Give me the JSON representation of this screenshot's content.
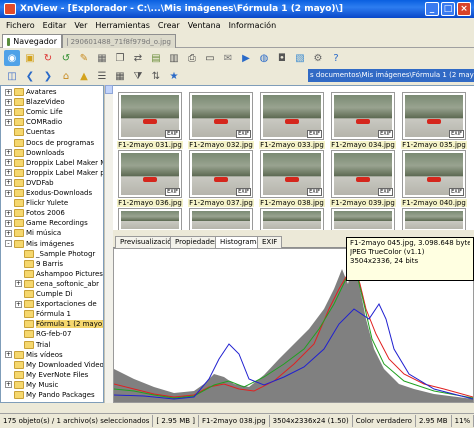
{
  "window": {
    "title": "XnView - [Explorador - C:\\...\\Mis imágenes\\Fórmula 1 (2 mayo)\\]"
  },
  "menu": [
    "Fichero",
    "Editar",
    "Ver",
    "Herramientas",
    "Crear",
    "Ventana",
    "Información"
  ],
  "tabs": [
    {
      "label": "Navegador"
    },
    {
      "label": "290601488_71f8f979d_o.jpg"
    }
  ],
  "path": "s documentos\\Mis imágenes\\Fórmula 1 (2 mayo)\\",
  "tree": {
    "items": [
      {
        "label": "Avatares",
        "pm": "+"
      },
      {
        "label": "BlazeVideo",
        "pm": "+"
      },
      {
        "label": "Comic Life",
        "pm": "+"
      },
      {
        "label": "COMRadio",
        "pm": "+"
      },
      {
        "label": "Cuentas",
        "pm": ""
      },
      {
        "label": "Docs de programas",
        "pm": ""
      },
      {
        "label": "Downloads",
        "pm": "+"
      },
      {
        "label": "Droppix Label Maker M",
        "pm": "+"
      },
      {
        "label": "Droppix Label Maker p",
        "pm": "+"
      },
      {
        "label": "DVDFab",
        "pm": "+"
      },
      {
        "label": "Exodus-Downloads",
        "pm": "+"
      },
      {
        "label": "Flickr Yulete",
        "pm": ""
      },
      {
        "label": "Fotos 2006",
        "pm": "+"
      },
      {
        "label": "Game Recordings",
        "pm": "+"
      },
      {
        "label": "Mi música",
        "pm": "+"
      },
      {
        "label": "Mis imágenes",
        "pm": "-"
      },
      {
        "label": "_Sample Photogr",
        "pm": ""
      },
      {
        "label": "9 Barris",
        "pm": ""
      },
      {
        "label": "Ashampoo Pictures",
        "pm": ""
      },
      {
        "label": "cena_softonic_abr",
        "pm": "+"
      },
      {
        "label": "Cumple Di",
        "pm": ""
      },
      {
        "label": "Exportaciones de",
        "pm": "+"
      },
      {
        "label": "Fórmula 1",
        "pm": ""
      },
      {
        "label": "Fórmula 1 (2 mayo)",
        "pm": "",
        "selected": true
      },
      {
        "label": "RG-feb-07",
        "pm": ""
      },
      {
        "label": "Trial",
        "pm": ""
      },
      {
        "label": "Mis vídeos",
        "pm": "+"
      },
      {
        "label": "My Downloaded Video",
        "pm": ""
      },
      {
        "label": "My EverNote Files",
        "pm": ""
      },
      {
        "label": "My Music",
        "pm": "+"
      },
      {
        "label": "My Pando Packages",
        "pm": ""
      }
    ]
  },
  "thumbnails": [
    {
      "caption": "F1-2mayo 031.jpg"
    },
    {
      "caption": "F1-2mayo 032.jpg"
    },
    {
      "caption": "F1-2mayo 033.jpg"
    },
    {
      "caption": "F1-2mayo 034.jpg"
    },
    {
      "caption": "F1-2mayo 035.jpg"
    },
    {
      "caption": "F1-2mayo 036.jpg"
    },
    {
      "caption": "F1-2mayo 037.jpg"
    },
    {
      "caption": "F1-2mayo 038.jpg"
    },
    {
      "caption": "F1-2mayo 039.jpg"
    },
    {
      "caption": "F1-2mayo 040.jpg"
    }
  ],
  "exif_badge": "EXIF",
  "lower_tabs": [
    "Previsualización",
    "Propiedades",
    "Histograma",
    "EXIF"
  ],
  "tooltip": {
    "line1": "F1-2mayo 045.jpg, 3.098.648 bytes, 02-",
    "line2": "JPEG TrueColor (v1.1)",
    "line3": "3504x2336, 24 bits"
  },
  "status": {
    "objects": "175 objeto(s) / 1 archivo(s) seleccionados",
    "size": "[ 2.95 MB ]",
    "filename": "F1-2mayo 038.jpg",
    "dims": "3504x2336x24 (1.50)",
    "color": "Color verdadero",
    "filesize": "2.95 MB",
    "zoom": "11%"
  },
  "histogram_colors": {
    "gray": "#808080",
    "red": "#e02020",
    "green": "#20a020",
    "blue": "#2020d0"
  }
}
